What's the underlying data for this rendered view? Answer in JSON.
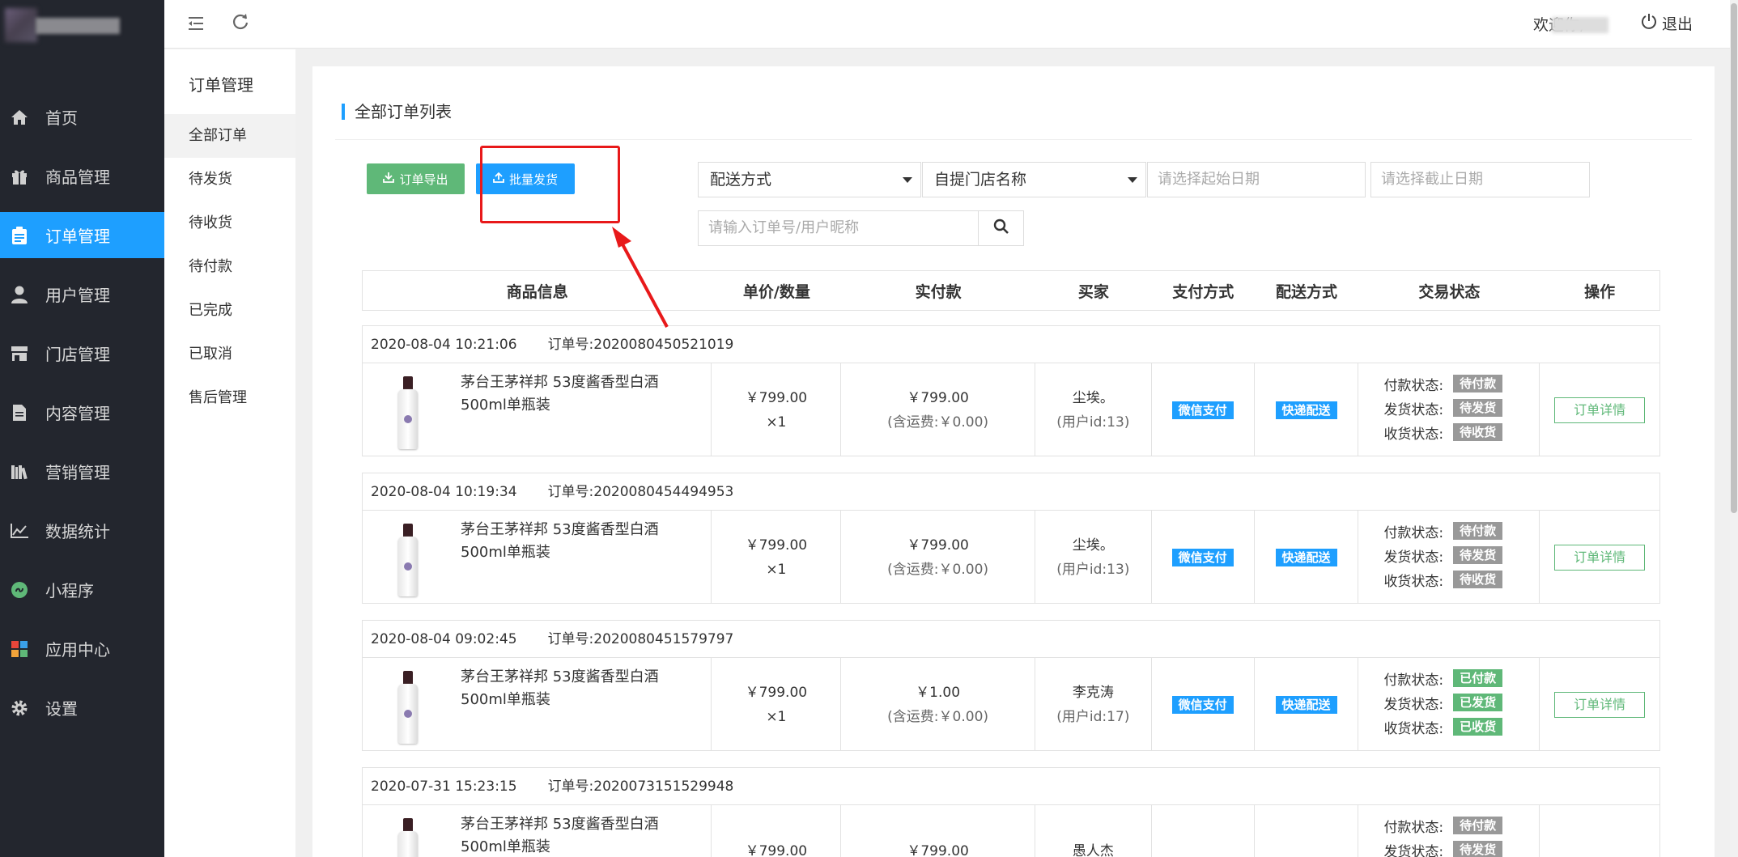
{
  "app": {
    "accent_color": "#1e9fff",
    "sidebar_bg": "#23262e"
  },
  "sidebar": {
    "items": [
      {
        "label": "首页",
        "icon": "home-icon",
        "active": false
      },
      {
        "label": "商品管理",
        "icon": "gift-icon",
        "active": false
      },
      {
        "label": "订单管理",
        "icon": "clipboard-icon",
        "active": true
      },
      {
        "label": "用户管理",
        "icon": "user-icon",
        "active": false
      },
      {
        "label": "门店管理",
        "icon": "store-icon",
        "active": false
      },
      {
        "label": "内容管理",
        "icon": "document-icon",
        "active": false
      },
      {
        "label": "营销管理",
        "icon": "books-icon",
        "active": false
      },
      {
        "label": "数据统计",
        "icon": "line-chart-icon",
        "active": false
      },
      {
        "label": "小程序",
        "icon": "mini-program-icon",
        "active": false
      },
      {
        "label": "应用中心",
        "icon": "apps-icon",
        "active": false
      },
      {
        "label": "设置",
        "icon": "gear-icon",
        "active": false
      }
    ]
  },
  "topbar": {
    "welcome": "欢迎你,",
    "logout": "退出"
  },
  "subnav": {
    "title": "订单管理",
    "items": [
      "全部订单",
      "待发货",
      "待收货",
      "待付款",
      "已完成",
      "已取消",
      "售后管理"
    ]
  },
  "main": {
    "title": "全部订单列表",
    "export_label": "订单导出",
    "batch_ship_label": "批量发货",
    "filters": {
      "delivery_method": "配送方式",
      "store_name": "自提门店名称",
      "start_date_placeholder": "请选择起始日期",
      "end_date_placeholder": "请选择截止日期",
      "search_placeholder": "请输入订单号/用户昵称"
    },
    "columns": [
      "商品信息",
      "单价/数量",
      "实付款",
      "买家",
      "支付方式",
      "配送方式",
      "交易状态",
      "操作"
    ],
    "orders": [
      {
        "time": "2020-08-04 10:21:06",
        "order_no": "订单号:2020080450521019",
        "product": "茅台王茅祥邦 53度酱香型白酒500ml单瓶装",
        "price": "￥799.00",
        "qty": "×1",
        "paid": "￥799.00",
        "shipping": "(含运费:￥0.00)",
        "buyer": "尘埃。",
        "buyer_id": "(用户id:13)",
        "pay_method": "微信支付",
        "delivery": "快递配送",
        "pay_status_label": "付款状态:",
        "pay_status": "待付款",
        "ship_status_label": "发货状态:",
        "ship_status": "待发货",
        "recv_status_label": "收货状态:",
        "recv_status": "待收货",
        "action": "订单详情"
      },
      {
        "time": "2020-08-04 10:19:34",
        "order_no": "订单号:2020080454494953",
        "product": "茅台王茅祥邦 53度酱香型白酒500ml单瓶装",
        "price": "￥799.00",
        "qty": "×1",
        "paid": "￥799.00",
        "shipping": "(含运费:￥0.00)",
        "buyer": "尘埃。",
        "buyer_id": "(用户id:13)",
        "pay_method": "微信支付",
        "delivery": "快递配送",
        "pay_status_label": "付款状态:",
        "pay_status": "待付款",
        "ship_status_label": "发货状态:",
        "ship_status": "待发货",
        "recv_status_label": "收货状态:",
        "recv_status": "待收货",
        "action": "订单详情"
      },
      {
        "time": "2020-08-04 09:02:45",
        "order_no": "订单号:2020080451579797",
        "product": "茅台王茅祥邦 53度酱香型白酒500ml单瓶装",
        "price": "￥799.00",
        "qty": "×1",
        "paid": "￥1.00",
        "shipping": "(含运费:￥0.00)",
        "buyer": "李克涛",
        "buyer_id": "(用户id:17)",
        "pay_method": "微信支付",
        "delivery": "快递配送",
        "pay_status_label": "付款状态:",
        "pay_status": "已付款",
        "ship_status_label": "发货状态:",
        "ship_status": "已发货",
        "recv_status_label": "收货状态:",
        "recv_status": "已收货",
        "action": "订单详情"
      },
      {
        "time": "2020-07-31 15:23:15",
        "order_no": "订单号:2020073151529948",
        "product": "茅台王茅祥邦 53度酱香型白酒500ml单瓶装",
        "price": "￥799.00",
        "qty": "",
        "paid": "￥799.00",
        "shipping": "",
        "buyer": "愚人杰",
        "buyer_id": "",
        "pay_method": "",
        "delivery": "",
        "pay_status_label": "付款状态:",
        "pay_status": "待付款",
        "ship_status_label": "发货状态:",
        "ship_status": "待发货",
        "recv_status_label": "",
        "recv_status": "",
        "action": ""
      }
    ]
  }
}
